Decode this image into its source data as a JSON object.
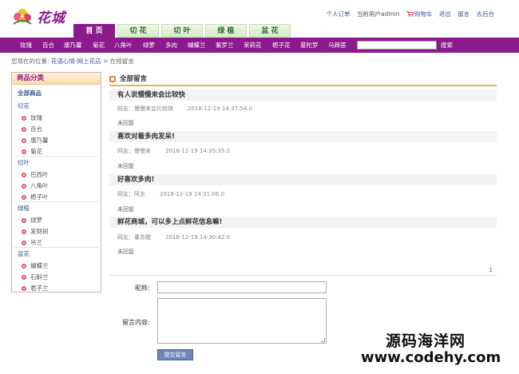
{
  "header": {
    "logo_text": "花城",
    "tabs": [
      {
        "label": "首 页",
        "active": true
      },
      {
        "label": "切 花",
        "active": false
      },
      {
        "label": "切 叶",
        "active": false
      },
      {
        "label": "绿 植",
        "active": false
      },
      {
        "label": "盆 花",
        "active": false
      }
    ],
    "user_links": {
      "orders": "个人订单",
      "current_user": "当前用户admin",
      "cart": "购物车",
      "logout": "退出",
      "message": "留言",
      "admin": "去后台"
    }
  },
  "catnav": {
    "items": [
      "玫瑰",
      "百合",
      "康乃馨",
      "菊花",
      "八角叶",
      "绿萝",
      "多肉",
      "蝴蝶兰",
      "紫罗兰",
      "茉莉花",
      "栀子花",
      "曼陀罗",
      "马蹄莲"
    ],
    "search_value": "",
    "search_label": "搜索"
  },
  "breadcrumb": {
    "prefix": "您现在的位置:",
    "link": "花语心情-网上花店",
    "sep": ">",
    "current": "在线留言"
  },
  "sidebar": {
    "title": "商品分类",
    "all": "全部商品",
    "groups": [
      {
        "name": "切花",
        "items": [
          "玫瑰",
          "百合",
          "康乃馨",
          "菊花"
        ]
      },
      {
        "name": "切叶",
        "items": [
          "巴西叶",
          "八角叶",
          "栀子叶"
        ]
      },
      {
        "name": "绿植",
        "items": [
          "绿萝",
          "发财树",
          "吊兰"
        ]
      },
      {
        "name": "盆花",
        "items": [
          "蝴蝶兰",
          "石斛兰",
          "君子兰"
        ]
      }
    ]
  },
  "main": {
    "title": "全部留言",
    "messages": [
      {
        "title": "有人说慢慢来会比较快",
        "user": "网友：慢慢来会比较快",
        "time": "2018-12-19 14:37:54.0",
        "status": "未回复"
      },
      {
        "title": "喜欢对着多肉发呆!",
        "user": "网友：慢慢来",
        "time": "2018-12-19 14:35:35.0",
        "status": "未回复"
      },
      {
        "title": "好喜欢多肉!",
        "user": "网友：阿夫",
        "time": "2018-12-19 14:31:06.0",
        "status": "未回复"
      },
      {
        "title": "鲜花商城，可以多上点鲜花信息嘛!",
        "user": "网友：董苏醒",
        "time": "2018-12-19 14:30:42.0",
        "status": "未回复"
      }
    ],
    "page": "1"
  },
  "form": {
    "name_label": "昵称:",
    "name_value": "",
    "content_label": "留言内容:",
    "content_value": "",
    "submit_label": "提交留言"
  },
  "watermark": {
    "line1": "源码海洋网",
    "line2": "www.codehy.com"
  },
  "colors": {
    "brand": "#8c1a8c",
    "tab_green": "#2a6b2a",
    "link": "#3a5a9a",
    "accent_orange": "#f0b060"
  }
}
